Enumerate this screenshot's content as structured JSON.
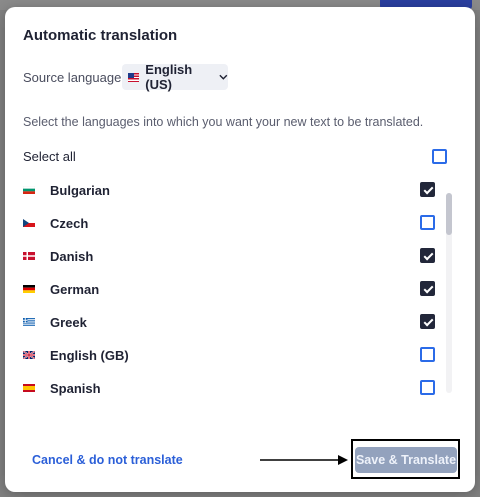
{
  "dialog": {
    "title": "Automatic translation",
    "source_label": "Source language:",
    "source_value": "English (US)",
    "instructions": "Select the languages into which you want your new text to be translated.",
    "select_all_label": "Select all",
    "select_all_checked": false
  },
  "languages": [
    {
      "label": "Bulgarian",
      "flag": "flag-bg-icon",
      "checked": true
    },
    {
      "label": "Czech",
      "flag": "flag-cz-icon",
      "checked": false
    },
    {
      "label": "Danish",
      "flag": "flag-dk-icon",
      "checked": true
    },
    {
      "label": "German",
      "flag": "flag-de-icon",
      "checked": true
    },
    {
      "label": "Greek",
      "flag": "flag-gr-icon",
      "checked": true
    },
    {
      "label": "English (GB)",
      "flag": "flag-gb-icon",
      "checked": false
    },
    {
      "label": "Spanish",
      "flag": "flag-es-icon",
      "checked": false
    }
  ],
  "footer": {
    "cancel_label": "Cancel & do not translate",
    "save_label": "Save & Translate"
  },
  "colors": {
    "accent": "#2b6be8",
    "checked_fill": "#22273a",
    "save_disabled": "#93a2bd"
  }
}
